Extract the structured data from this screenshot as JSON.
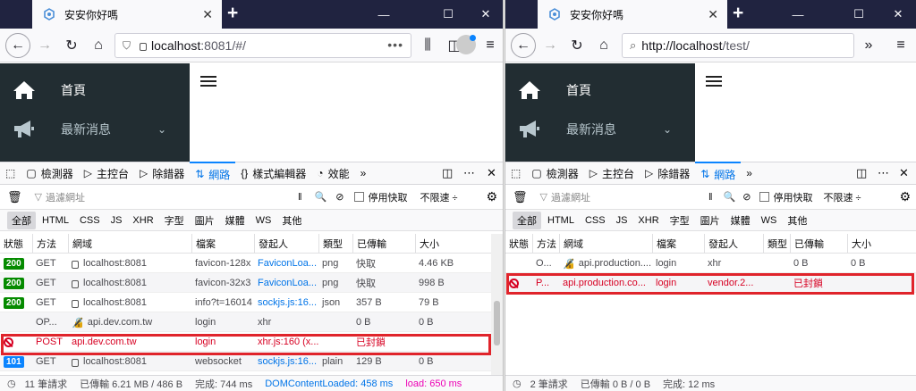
{
  "left": {
    "tab_title": "安安你好嗎",
    "url_host": "localhost",
    "url_rest": ":8081/#/",
    "sidebar": [
      {
        "label": "首頁"
      },
      {
        "label": "最新消息"
      }
    ],
    "devtools_tabs": [
      "檢測器",
      "主控台",
      "除錯器",
      "網路",
      "樣式編輯器",
      "效能"
    ],
    "filter_placeholder": "過濾網址",
    "disable_cache_label": "停用快取",
    "throttle_label": "不限速 ÷",
    "filters": [
      "全部",
      "HTML",
      "CSS",
      "JS",
      "XHR",
      "字型",
      "圖片",
      "媒體",
      "WS",
      "其他"
    ],
    "columns": [
      "狀態",
      "方法",
      "網域",
      "檔案",
      "發起人",
      "類型",
      "已傳輸",
      "大小"
    ],
    "rows": [
      {
        "status": "200",
        "method": "GET",
        "domain": "localhost:8081",
        "file": "favicon-128x",
        "initiator": "FaviconLoa...",
        "type": "png",
        "transferred": "快取",
        "size": "4.46 KB"
      },
      {
        "status": "200",
        "method": "GET",
        "domain": "localhost:8081",
        "file": "favicon-32x3",
        "initiator": "FaviconLoa...",
        "type": "png",
        "transferred": "快取",
        "size": "998 B"
      },
      {
        "status": "200",
        "method": "GET",
        "domain": "localhost:8081",
        "file": "info?t=16014",
        "initiator": "sockjs.js:16...",
        "type": "json",
        "transferred": "357 B",
        "size": "79 B"
      },
      {
        "status": "",
        "method": "OP...",
        "domain": "api.dev.com.tw",
        "file": "login",
        "initiator": "xhr",
        "type": "",
        "transferred": "0 B",
        "size": "0 B"
      },
      {
        "status": "blocked",
        "method": "POST",
        "domain": "api.dev.com.tw",
        "file": "login",
        "initiator": "xhr.js:160 (x...",
        "type": "",
        "transferred": "已封鎖",
        "size": ""
      },
      {
        "status": "101",
        "method": "GET",
        "domain": "localhost:8081",
        "file": "websocket",
        "initiator": "sockjs.js:16...",
        "type": "plain",
        "transferred": "129 B",
        "size": "0 B"
      }
    ],
    "footer": {
      "requests": "11 筆請求",
      "transferred": "已傳輸 6.21 MB / 486 B",
      "finish": "完成: 744 ms",
      "dcl": "DOMContentLoaded: 458 ms",
      "load": "load: 650 ms"
    }
  },
  "right": {
    "tab_title": "安安你好嗎",
    "url_host": "http://localhost",
    "url_rest": "/test/",
    "sidebar": [
      {
        "label": "首頁"
      },
      {
        "label": "最新消息"
      }
    ],
    "devtools_tabs": [
      "檢測器",
      "主控台",
      "除錯器",
      "網路"
    ],
    "filter_placeholder": "過濾網址",
    "disable_cache_label": "停用快取",
    "throttle_label": "不限速 ÷",
    "filters": [
      "全部",
      "HTML",
      "CSS",
      "JS",
      "XHR",
      "字型",
      "圖片",
      "媒體",
      "WS",
      "其他"
    ],
    "columns": [
      "狀態",
      "方法",
      "網域",
      "檔案",
      "發起人",
      "類型",
      "已傳輸",
      "大小"
    ],
    "rows": [
      {
        "status": "",
        "method": "O...",
        "domain": "api.production....",
        "file": "login",
        "initiator": "xhr",
        "type": "",
        "transferred": "0 B",
        "size": "0 B"
      },
      {
        "status": "blocked",
        "method": "P...",
        "domain": "api.production.co...",
        "file": "login",
        "initiator": "vendor.2...",
        "type": "",
        "transferred": "已封鎖",
        "size": ""
      }
    ],
    "footer": {
      "requests": "2 筆請求",
      "transferred": "已傳輸 0 B / 0 B",
      "finish": "完成: 12 ms"
    }
  },
  "colors": {
    "titlebar": "#202340",
    "sidebar": "#222d32",
    "accent": "#0a84ff",
    "blocked": "#d70022",
    "highlight": "#e0242b"
  }
}
